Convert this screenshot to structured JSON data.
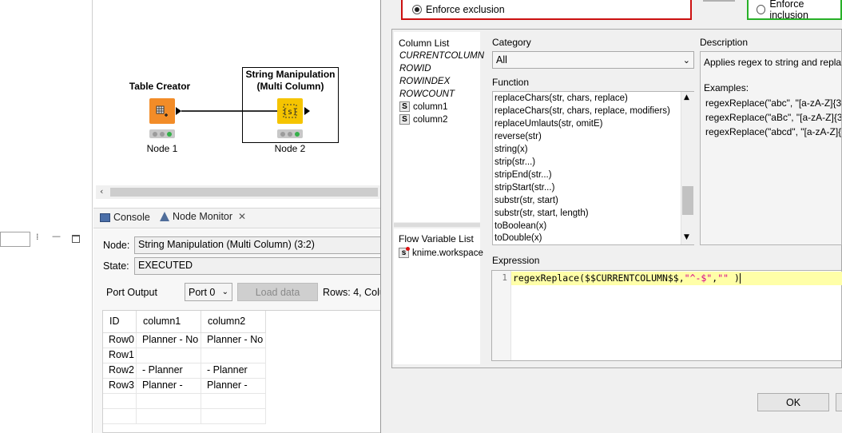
{
  "workflow": {
    "node1": {
      "title": "Table Creator",
      "label": "Node 1"
    },
    "node2": {
      "title": "String Manipulation (Multi Column)",
      "label": "Node 2"
    }
  },
  "bottom_panel": {
    "tabs": [
      {
        "label": "Console"
      },
      {
        "label": "Node Monitor"
      }
    ],
    "node_label": "Node:",
    "node_value": "String Manipulation (Multi Column)  (3:2)",
    "state_label": "State:",
    "state_value": "EXECUTED",
    "port_output_label": "Port Output",
    "port_select": "Port 0",
    "load_data": "Load data",
    "rows_info": "Rows: 4, Colu",
    "table": {
      "headers": [
        "ID",
        "column1",
        "column2"
      ],
      "rows": [
        [
          "Row0",
          "Planner - No",
          "Planner - No"
        ],
        [
          "Row1",
          "",
          ""
        ],
        [
          "Row2",
          "- Planner",
          "- Planner"
        ],
        [
          "Row3",
          "Planner -",
          "Planner -"
        ]
      ]
    }
  },
  "dialog": {
    "enforce_exclusion": "Enforce exclusion",
    "enforce_inclusion": "Enforce inclusion",
    "column_list_label": "Column List",
    "column_list": [
      "CURRENTCOLUMN",
      "ROWID",
      "ROWINDEX",
      "ROWCOUNT"
    ],
    "columns": [
      "column1",
      "column2"
    ],
    "flow_variable_label": "Flow Variable List",
    "flow_variables": [
      "knime.workspace"
    ],
    "category_label": "Category",
    "category_value": "All",
    "function_label": "Function",
    "functions": [
      "replaceChars(str, chars, replace)",
      "replaceChars(str, chars, replace, modifiers)",
      "replaceUmlauts(str, omitE)",
      "reverse(str)",
      "string(x)",
      "strip(str...)",
      "stripEnd(str...)",
      "stripStart(str...)",
      "substr(str, start)",
      "substr(str, start, length)",
      "toBoolean(x)",
      "toDouble(x)"
    ],
    "description_label": "Description",
    "description": {
      "summary": "Applies regex to string and repla",
      "examples_label": "Examples:",
      "examples": [
        "regexReplace(\"abc\", \"[a-zA-Z]{3}",
        "regexReplace(\"aBc\", \"[a-zA-Z]{3}",
        "regexReplace(\"abcd\", \"[a-zA-Z]{3"
      ]
    },
    "expression_label": "Expression",
    "expression": {
      "line_number": "1",
      "fn": "regexReplace(",
      "arg": "$$CURRENTCOLUMN$$,",
      "pattern": "\"^-$\"",
      "comma": ",",
      "replacement": "\"\"",
      "close": " )"
    },
    "ok": "OK"
  }
}
